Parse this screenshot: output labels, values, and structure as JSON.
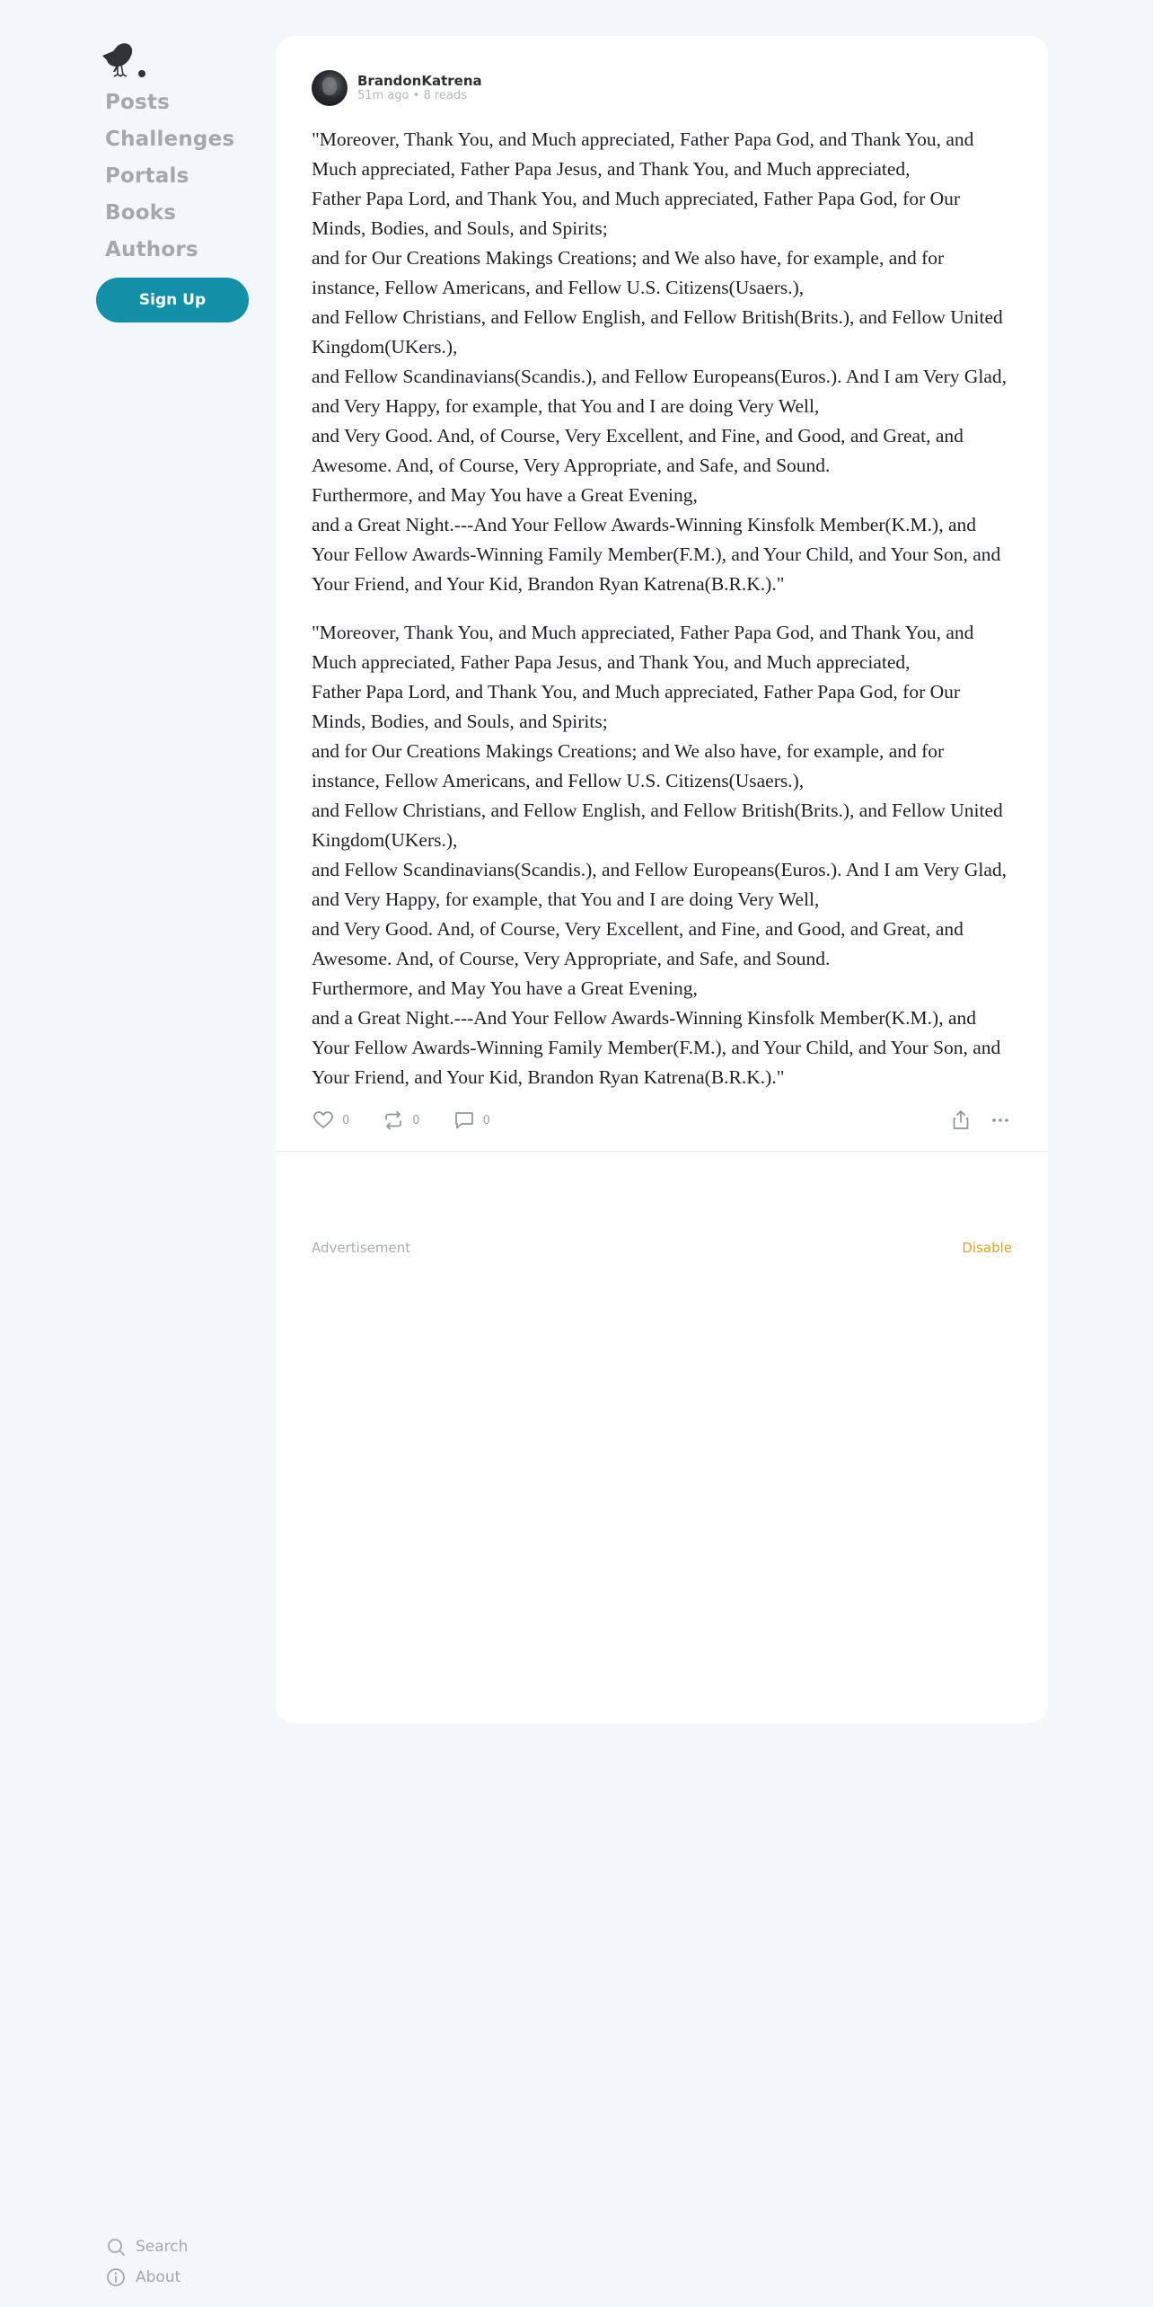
{
  "sidebar": {
    "logo": "crow-logo-icon",
    "nav": [
      "Posts",
      "Challenges",
      "Portals",
      "Books",
      "Authors"
    ],
    "signup_label": "Sign Up",
    "footer": [
      {
        "icon": "search-icon",
        "label": "Search"
      },
      {
        "icon": "info-icon",
        "label": "About"
      }
    ]
  },
  "post": {
    "author": "BrandonKatrena",
    "meta": "51m ago • 8 reads",
    "paragraphs": [
      [
        "\"Moreover, Thank You, and Much appreciated, Father Papa God, and Thank You, and Much appreciated, Father Papa Jesus, and Thank You, and Much appreciated,",
        "Father Papa Lord, and Thank You, and Much appreciated, Father Papa God, for Our Minds, Bodies, and Souls, and Spirits;",
        "and for Our Creations Makings Creations; and We also have, for example, and for instance, Fellow Americans, and Fellow U.S. Citizens(Usaers.),",
        "and Fellow Christians, and Fellow English, and Fellow British(Brits.), and Fellow United Kingdom(UKers.),",
        "and Fellow Scandinavians(Scandis.), and Fellow Europeans(Euros.). And I am Very Glad, and Very Happy, for example, that You and I are doing Very Well,",
        "and Very Good. And, of Course, Very Excellent, and Fine, and Good, and Great, and Awesome. And, of Course, Very Appropriate, and Safe, and Sound.",
        "Furthermore, and May You have a Great Evening,",
        "and a Great Night.---And Your Fellow Awards-Winning Kinsfolk Member(K.M.), and Your Fellow Awards-Winning Family Member(F.M.), and Your Child, and Your Son, and Your Friend, and Your Kid, Brandon Ryan Katrena(B.R.K.).\""
      ],
      [
        "\"Moreover, Thank You, and Much appreciated, Father Papa God, and Thank You, and Much appreciated, Father Papa Jesus, and Thank You, and Much appreciated,",
        "Father Papa Lord, and Thank You, and Much appreciated, Father Papa God, for Our Minds, Bodies, and Souls, and Spirits;",
        "and for Our Creations Makings Creations; and We also have, for example, and for instance, Fellow Americans, and Fellow U.S. Citizens(Usaers.),",
        "and Fellow Christians, and Fellow English, and Fellow British(Brits.), and Fellow United Kingdom(UKers.),",
        "and Fellow Scandinavians(Scandis.), and Fellow Europeans(Euros.). And I am Very Glad, and Very Happy, for example, that You and I are doing Very Well,",
        "and Very Good. And, of Course, Very Excellent, and Fine, and Good, and Great, and Awesome. And, of Course, Very Appropriate, and Safe, and Sound.",
        "Furthermore, and May You have a Great Evening,",
        "and a Great Night.---And Your Fellow Awards-Winning Kinsfolk Member(K.M.), and Your Fellow Awards-Winning Family Member(F.M.), and Your Child, and Your Son, and Your Friend, and Your Kid, Brandon Ryan Katrena(B.R.K.).\""
      ]
    ],
    "actions": {
      "likes": "0",
      "reposts": "0",
      "comments": "0"
    }
  },
  "ad": {
    "label": "Advertisement",
    "disable_label": "Disable"
  },
  "colors": {
    "background": "#f4f7fa",
    "accent": "#138fa8",
    "nav_text": "#a3a8ad",
    "disable": "#e0a126"
  }
}
